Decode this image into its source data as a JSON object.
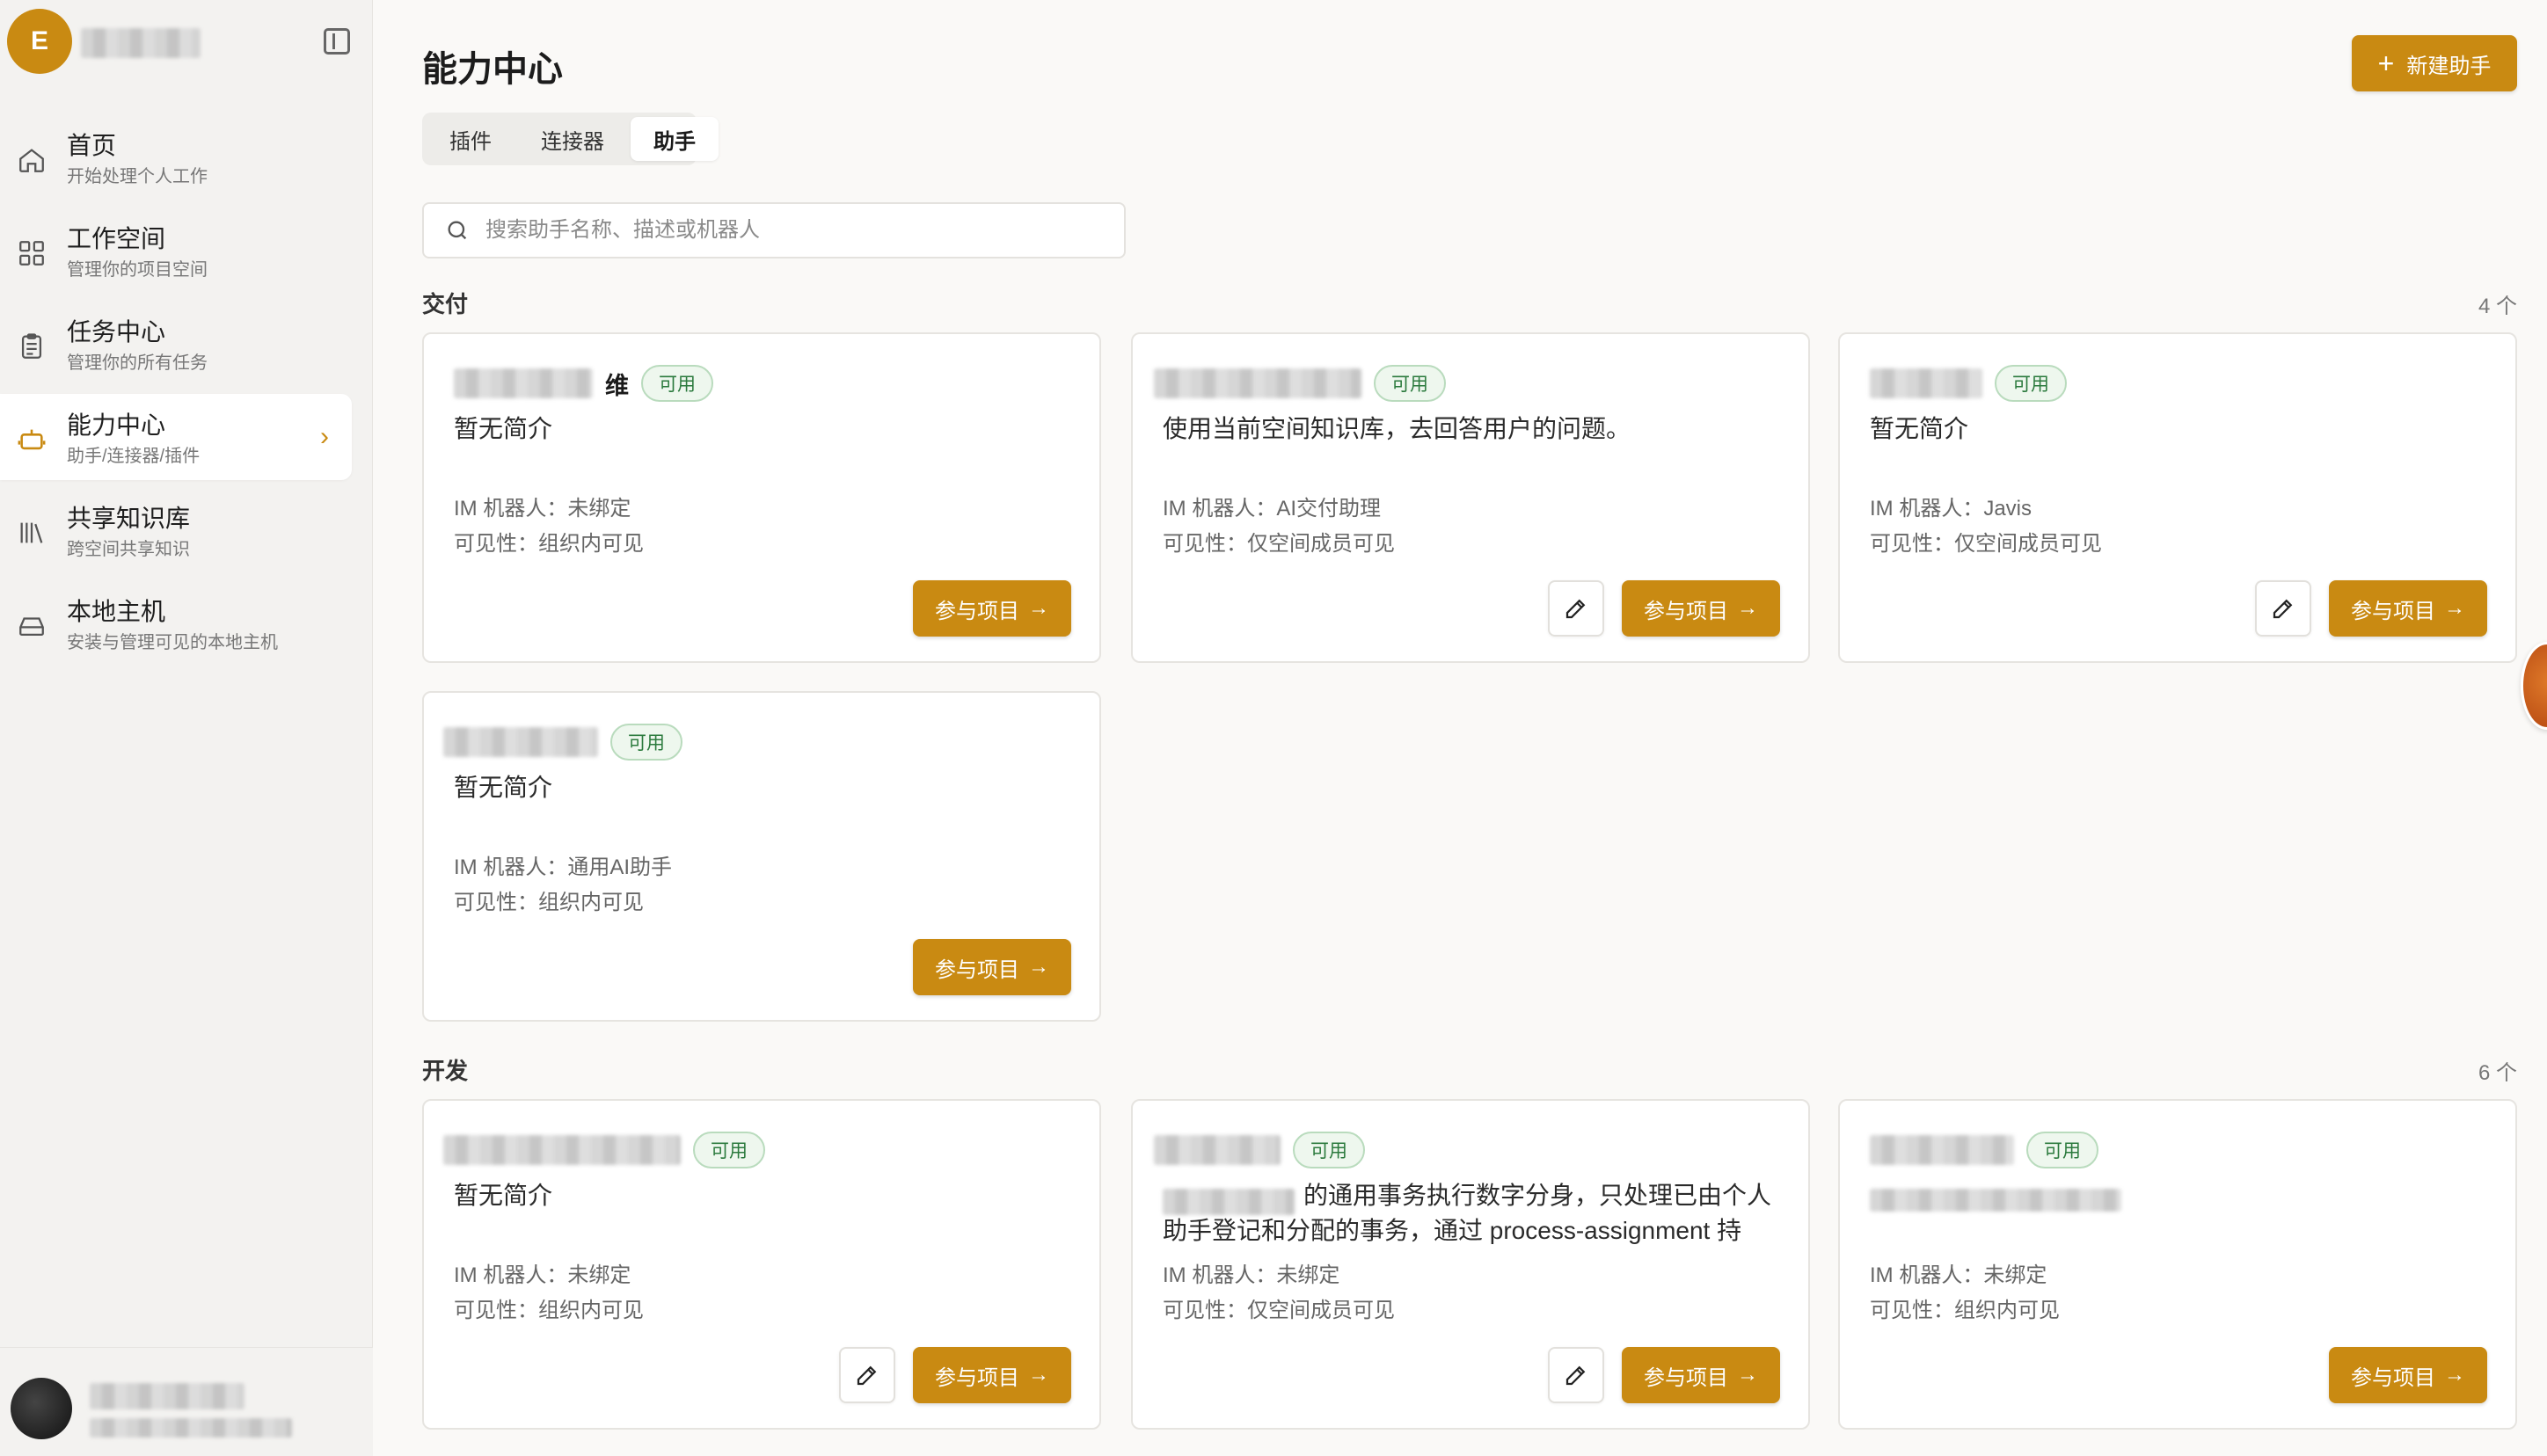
{
  "sidebar": {
    "workspace_initial": "E",
    "items": [
      {
        "title": "首页",
        "sub": "开始处理个人工作",
        "icon": "home-icon"
      },
      {
        "title": "工作空间",
        "sub": "管理你的项目空间",
        "icon": "grid-icon"
      },
      {
        "title": "任务中心",
        "sub": "管理你的所有任务",
        "icon": "clipboard-icon"
      },
      {
        "title": "能力中心",
        "sub": "助手/连接器/插件",
        "icon": "robot-icon",
        "active": true
      },
      {
        "title": "共享知识库",
        "sub": "跨空间共享知识",
        "icon": "library-icon"
      },
      {
        "title": "本地主机",
        "sub": "安装与管理可见的本地主机",
        "icon": "drive-icon"
      }
    ]
  },
  "header": {
    "title": "能力中心",
    "new_button": "新建助手"
  },
  "tabs": [
    {
      "label": "插件"
    },
    {
      "label": "连接器"
    },
    {
      "label": "助手",
      "active": true
    }
  ],
  "search": {
    "placeholder": "搜索助手名称、描述或机器人"
  },
  "sections": [
    {
      "label": "交付",
      "count": "4 个",
      "cards": [
        {
          "name_suffix": "维",
          "badge": "可用",
          "desc": "暂无简介",
          "im": "IM 机器人：未绑定",
          "visibility": "可见性：组织内可见",
          "editable": false,
          "join": "参与项目"
        },
        {
          "name_suffix": "",
          "badge": "可用",
          "desc": "使用当前空间知识库，去回答用户的问题。",
          "im": "IM 机器人：AI交付助理",
          "visibility": "可见性：仅空间成员可见",
          "editable": true,
          "join": "参与项目"
        },
        {
          "name_suffix": "",
          "badge": "可用",
          "desc": "暂无简介",
          "im": "IM 机器人：Javis",
          "visibility": "可见性：仅空间成员可见",
          "editable": true,
          "join": "参与项目"
        },
        {
          "name_suffix": "",
          "badge": "可用",
          "desc": "暂无简介",
          "im": "IM 机器人：通用AI助手",
          "visibility": "可见性：组织内可见",
          "editable": false,
          "join": "参与项目"
        }
      ]
    },
    {
      "label": "开发",
      "count": "6 个",
      "cards": [
        {
          "name_suffix": "",
          "badge": "可用",
          "desc": "暂无简介",
          "im": "IM 机器人：未绑定",
          "visibility": "可见性：组织内可见",
          "editable": true,
          "join": "参与项目"
        },
        {
          "name_suffix": "",
          "badge": "可用",
          "desc": "的通用事务执行数字分身，只处理已由个人助手登记和分配的事务，通过 process-assignment 持续...",
          "im": "IM 机器人：未绑定",
          "visibility": "可见性：仅空间成员可见",
          "editable": true,
          "join": "参与项目"
        },
        {
          "name_suffix": "",
          "badge": "可用",
          "desc": "",
          "im": "IM 机器人：未绑定",
          "visibility": "可见性：组织内可见",
          "editable": false,
          "join": "参与项目"
        }
      ]
    }
  ],
  "colors": {
    "accent": "#c98a12",
    "badge_text": "#2b7a3d",
    "badge_bg": "#eef7ee"
  }
}
